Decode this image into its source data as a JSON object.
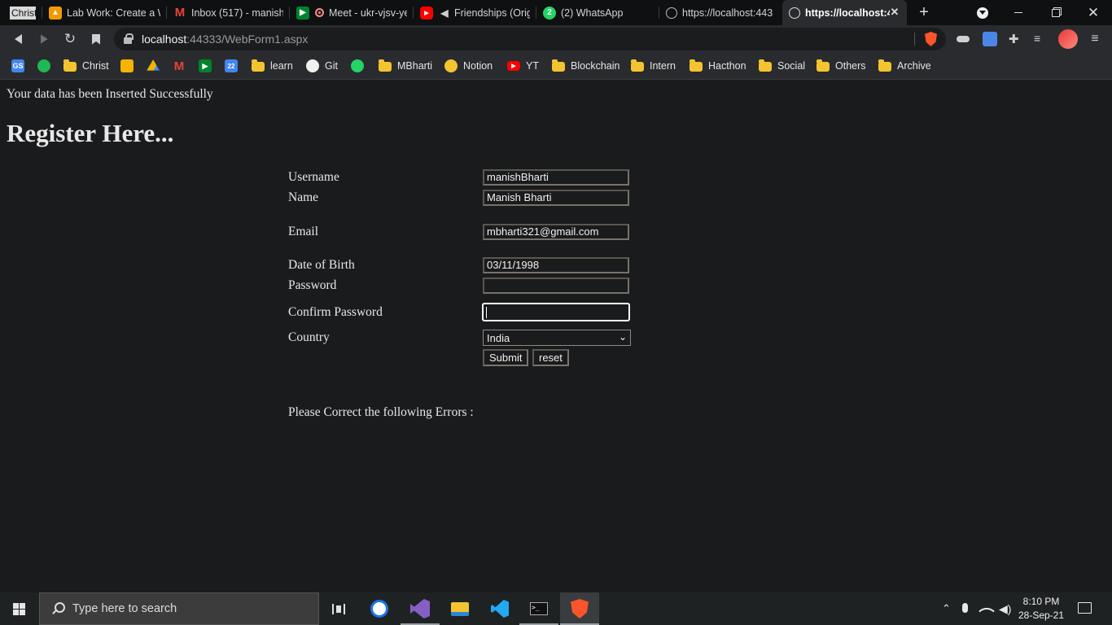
{
  "browser": {
    "tabs": [
      {
        "label": "Christ",
        "favicon": "christ-favicon"
      },
      {
        "label": "Lab Work: Create a W",
        "favicon": "classroom-favicon"
      },
      {
        "label": "Inbox (517) - manish.",
        "favicon": "gmail-favicon"
      },
      {
        "label": "Meet - ukr-vjsv-ye",
        "favicon": "meet-favicon"
      },
      {
        "label": "Friendships (Origi",
        "favicon": "youtube-favicon"
      },
      {
        "label": "(2) WhatsApp",
        "favicon": "whatsapp-favicon"
      },
      {
        "label": "https://localhost:443",
        "favicon": "globe-favicon"
      },
      {
        "label": "https://localhost:4",
        "favicon": "globe-favicon"
      }
    ],
    "address": {
      "host": "localhost",
      "rest": ":44333/WebForm1.aspx"
    },
    "bookmarks": [
      {
        "label": "",
        "icon": "gs-icon"
      },
      {
        "label": "",
        "icon": "spotify-icon"
      },
      {
        "label": "Christ",
        "icon": "folder-icon"
      },
      {
        "label": "",
        "icon": "classroom-icon"
      },
      {
        "label": "",
        "icon": "drive-icon"
      },
      {
        "label": "",
        "icon": "gmail-icon"
      },
      {
        "label": "",
        "icon": "meet-icon"
      },
      {
        "label": "",
        "icon": "calendar-icon"
      },
      {
        "label": "learn",
        "icon": "folder-icon"
      },
      {
        "label": "Git",
        "icon": "github-icon"
      },
      {
        "label": "",
        "icon": "whatsapp-icon"
      },
      {
        "label": "MBharti",
        "icon": "folder-icon"
      },
      {
        "label": "Notion",
        "icon": "notion-icon"
      },
      {
        "label": "YT",
        "icon": "youtube-icon"
      },
      {
        "label": "Blockchain",
        "icon": "folder-icon"
      },
      {
        "label": "Intern",
        "icon": "folder-icon"
      },
      {
        "label": "Hacthon",
        "icon": "folder-icon"
      },
      {
        "label": "Social",
        "icon": "folder-icon"
      },
      {
        "label": "Others",
        "icon": "folder-icon"
      },
      {
        "label": "Archive",
        "icon": "folder-icon"
      }
    ]
  },
  "page": {
    "success_message": "Your data has been Inserted Successfully",
    "heading": "Register Here...",
    "form": {
      "username_label": "Username",
      "username_value": "manishBharti",
      "name_label": "Name",
      "name_value": "Manish Bharti",
      "email_label": "Email",
      "email_value": "mbharti321@gmail.com",
      "dob_label": "Date of Birth",
      "dob_value": "03/11/1998",
      "password_label": "Password",
      "password_value": "",
      "confirm_label": "Confirm Password",
      "confirm_value": "",
      "country_label": "Country",
      "country_value": "India",
      "submit_label": "Submit",
      "reset_label": "reset"
    },
    "errors_heading": "Please Correct the following Errors :"
  },
  "taskbar": {
    "search_placeholder": "Type here to search",
    "time": "8:10 PM",
    "date": "28-Sep-21"
  }
}
